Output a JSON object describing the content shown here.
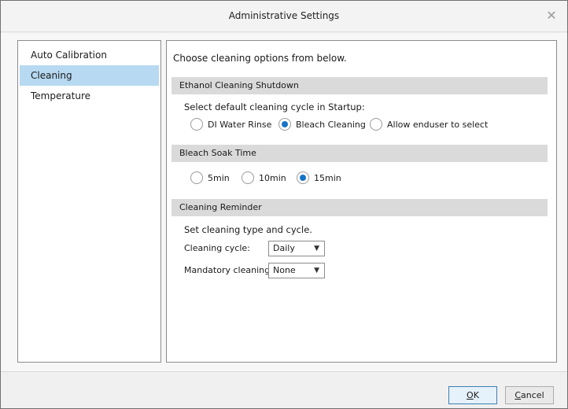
{
  "window": {
    "title": "Administrative Settings",
    "close_glyph": "✕"
  },
  "sidebar": {
    "items": [
      {
        "label": "Auto Calibration",
        "selected": false
      },
      {
        "label": "Cleaning",
        "selected": true
      },
      {
        "label": "Temperature",
        "selected": false
      }
    ]
  },
  "content": {
    "intro": "Choose cleaning options from below.",
    "ethanol": {
      "header": "Ethanol Cleaning Shutdown",
      "prompt": "Select default cleaning cycle in Startup:",
      "options": [
        {
          "label": "DI Water Rinse",
          "checked": false
        },
        {
          "label": "Bleach Cleaning",
          "checked": true
        },
        {
          "label": "Allow enduser to select",
          "checked": false
        }
      ]
    },
    "soak": {
      "header": "Bleach Soak Time",
      "options": [
        {
          "label": "5min",
          "checked": false
        },
        {
          "label": "10min",
          "checked": false
        },
        {
          "label": "15min",
          "checked": true
        }
      ]
    },
    "reminder": {
      "header": "Cleaning Reminder",
      "prompt": "Set cleaning type and cycle.",
      "cycle_label": "Cleaning cycle:",
      "cycle_value": "Daily",
      "mandatory_label": "Mandatory cleaning:",
      "mandatory_value": "None",
      "dropdown_glyph": "▼"
    }
  },
  "footer": {
    "ok_mnemonic": "O",
    "ok_rest": "K",
    "cancel_mnemonic": "C",
    "cancel_rest": "ancel"
  },
  "colors": {
    "selection": "#b7d9f1",
    "radio_accent": "#1573c7",
    "section_header": "#dadada"
  }
}
